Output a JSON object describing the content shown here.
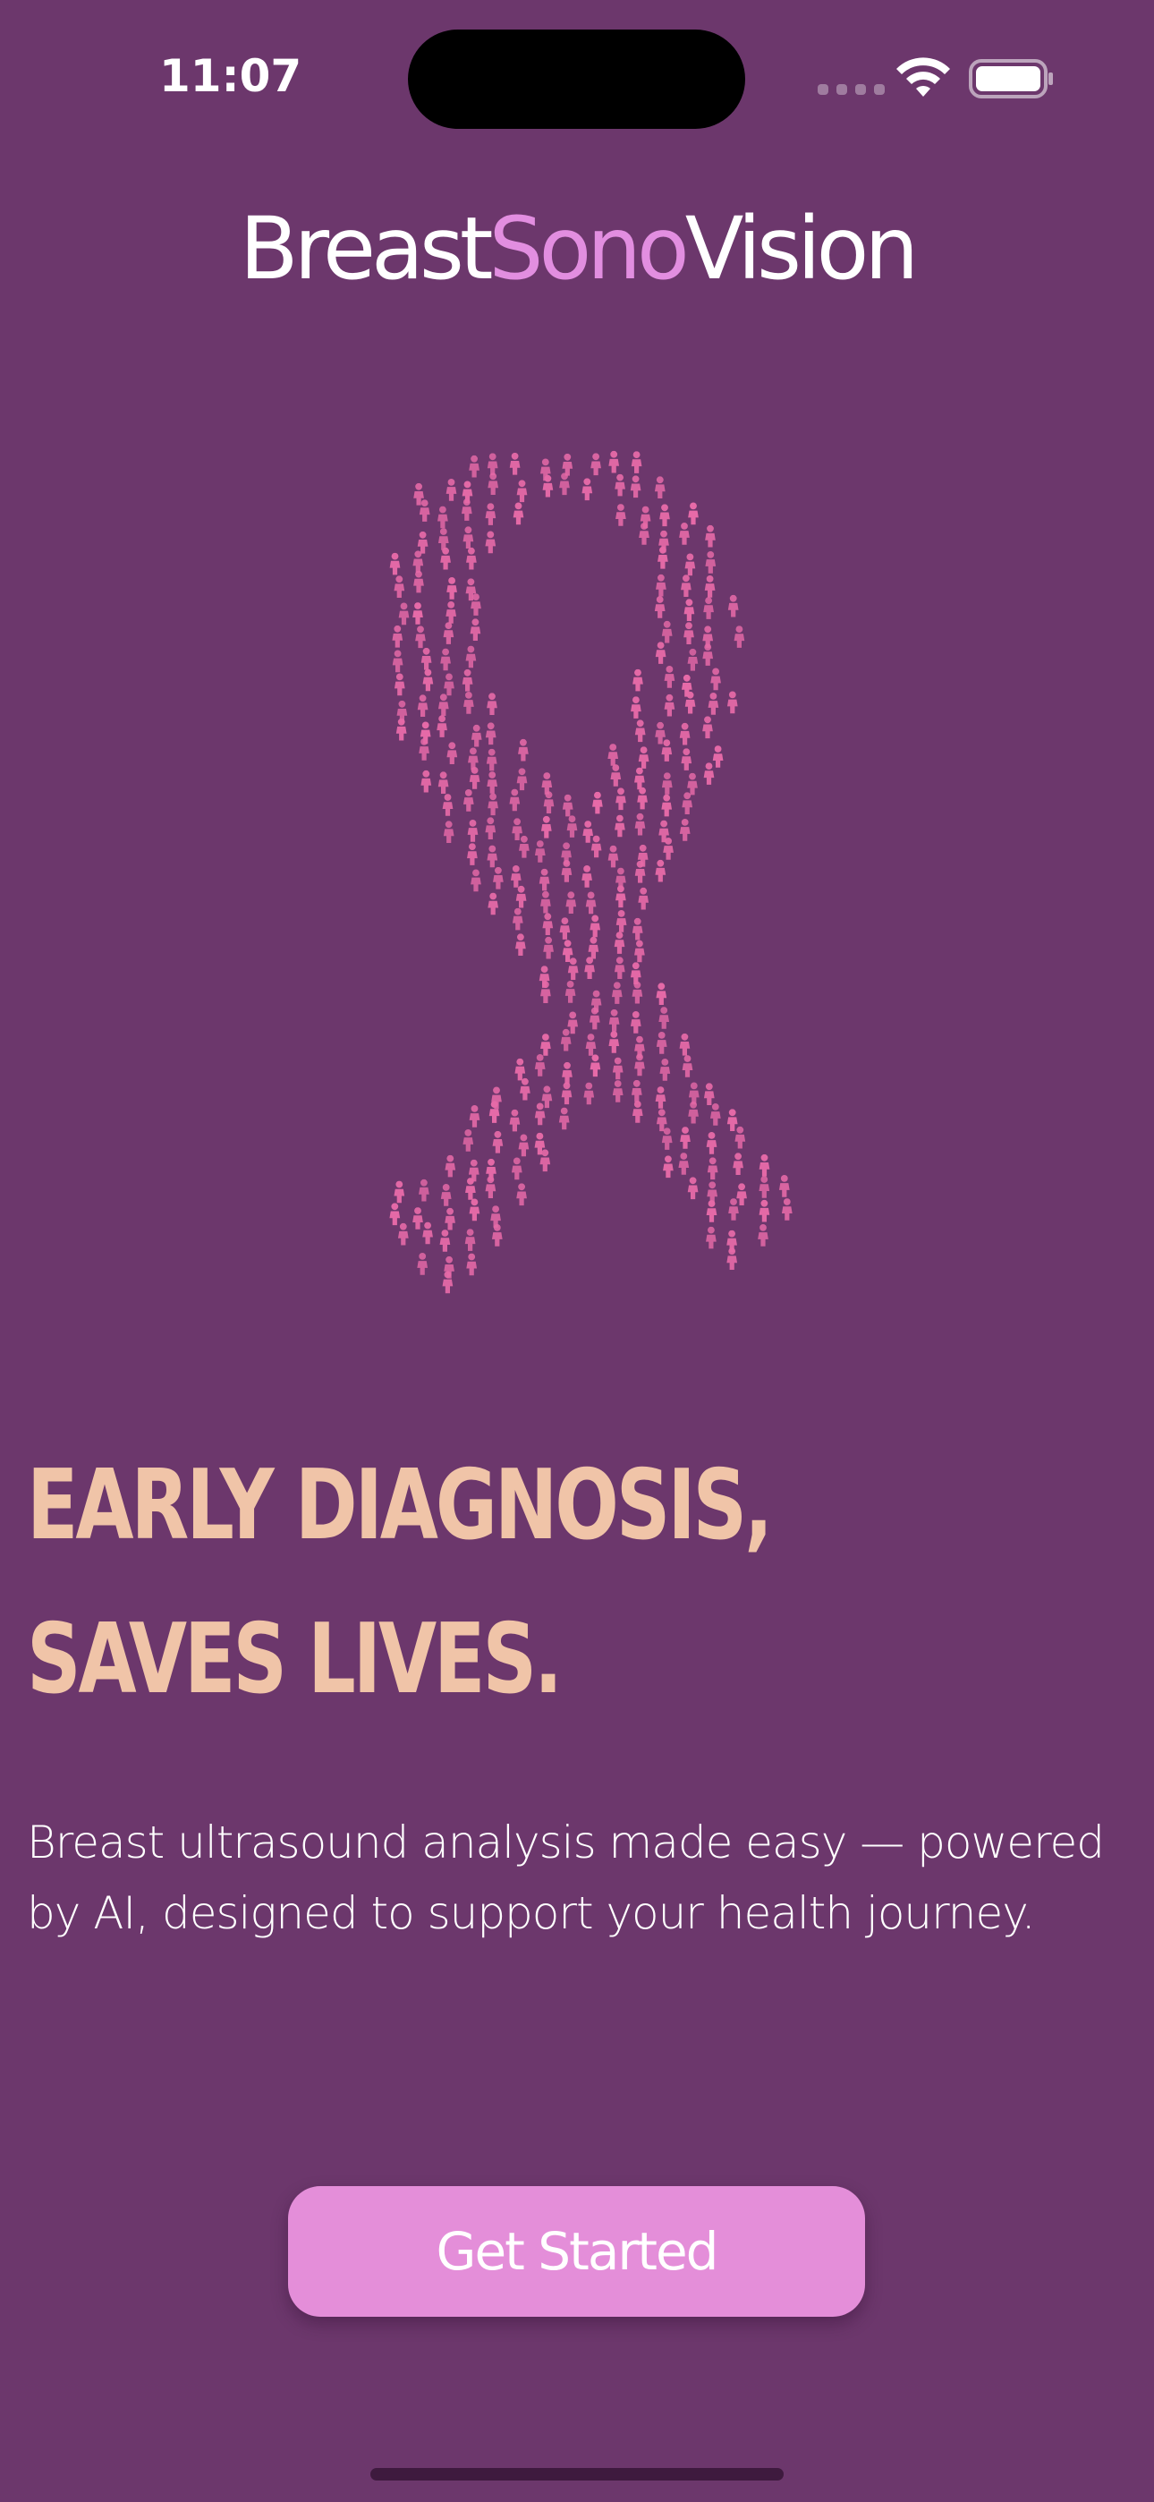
{
  "status_bar": {
    "time": "11:07"
  },
  "header": {
    "title_part1": "Breast",
    "title_part2": "Sono",
    "title_part3": "Vision"
  },
  "hero": {
    "illustration": "pink-ribbon-of-women-figures"
  },
  "headline": {
    "line1": "EARLY DIAGNOSIS,",
    "line2": "SAVES LIVES."
  },
  "description": "Breast ultrasound analysis made easy — powered by AI, designed to support your health journey.",
  "cta": {
    "label": "Get Started"
  },
  "colors": {
    "background": "#6c376c",
    "accent": "#e28ee0",
    "headline": "#f0c4a8",
    "button": "#e48ed9",
    "ribbon_figures": "#e66aa8"
  }
}
